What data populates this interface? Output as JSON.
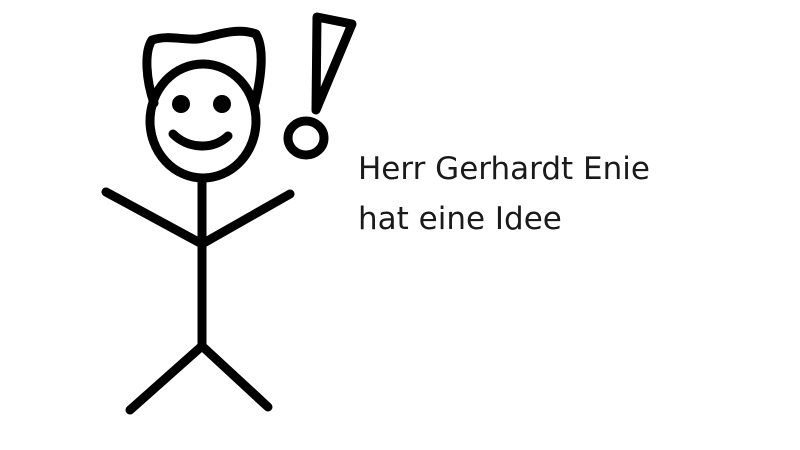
{
  "caption": {
    "line1": "Herr Gerhardt Enie",
    "line2": "hat eine Idee"
  },
  "drawing": {
    "figure": "stick-figure",
    "symbol": "exclamation-mark",
    "stroke_color": "#000000"
  }
}
